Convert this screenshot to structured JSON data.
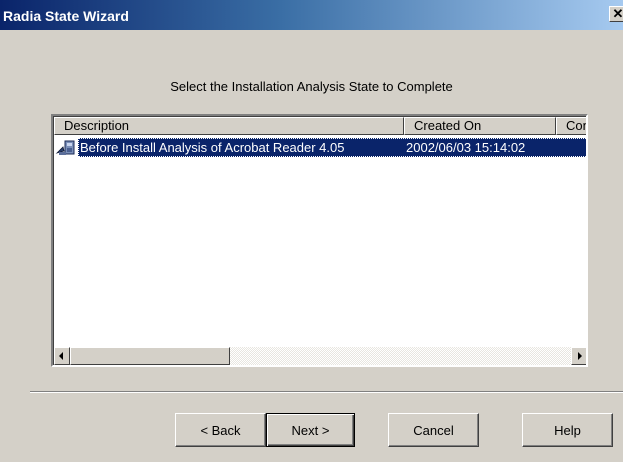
{
  "window": {
    "title": "Radia State Wizard",
    "close_glyph": "✕"
  },
  "instruction": "Select the Installation Analysis State to Complete",
  "list": {
    "columns": [
      "Description",
      "Created On",
      "Con"
    ],
    "rows": [
      {
        "icon": "package-state-icon",
        "description": "Before Install Analysis of Acrobat Reader 4.05",
        "created_on": "2002/06/03 15:14:02",
        "selected": true
      }
    ]
  },
  "buttons": {
    "back": "< Back",
    "next": "Next >",
    "cancel": "Cancel",
    "help": "Help"
  },
  "colors": {
    "selection": "#0a246a",
    "face": "#d4d0c8"
  }
}
